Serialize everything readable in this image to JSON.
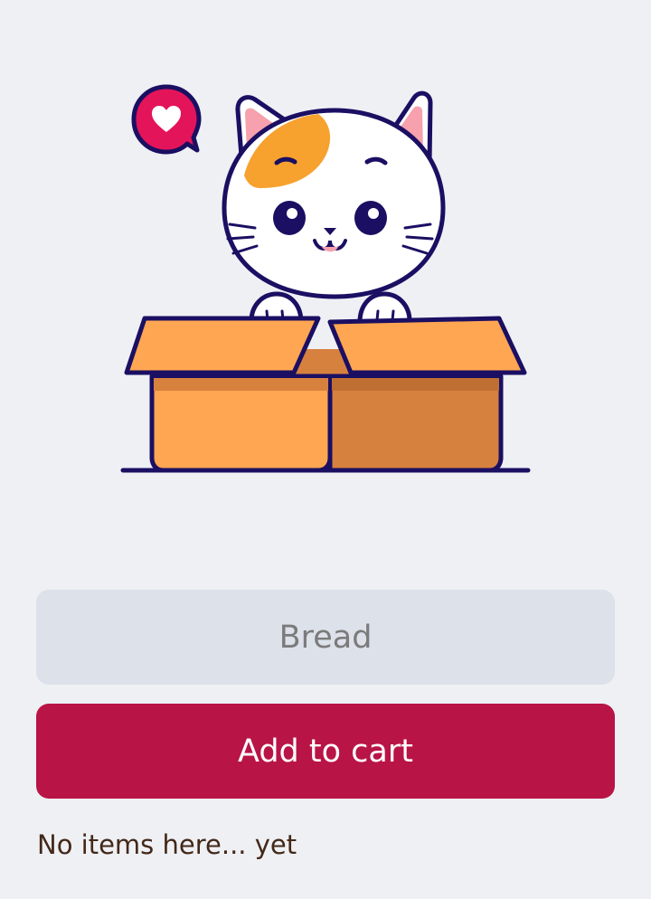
{
  "illustration": {
    "description_icon": "cat-in-box-icon",
    "colors": {
      "box_light": "#ffa652",
      "box_dark": "#d7813f",
      "outline": "#1a0f62",
      "heart_bubble": "#e4145a",
      "cat_patch": "#f7a12e",
      "cat_white": "#ffffff"
    }
  },
  "form": {
    "item_placeholder": "Bread",
    "add_button_label": "Add to cart"
  },
  "list": {
    "empty_message": "No items here... yet"
  }
}
